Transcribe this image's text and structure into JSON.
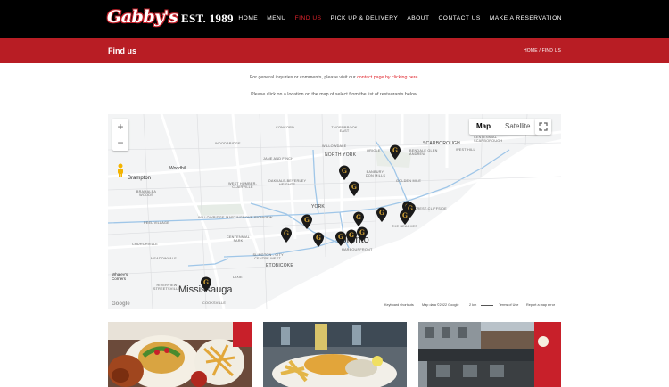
{
  "header": {
    "logo_text": "Gabby's",
    "est_text": "EST. 1989",
    "nav": [
      {
        "label": "HOME",
        "active": false
      },
      {
        "label": "MENU",
        "active": false
      },
      {
        "label": "FIND US",
        "active": true
      },
      {
        "label": "PICK UP & DELIVERY",
        "active": false
      },
      {
        "label": "ABOUT",
        "active": false
      },
      {
        "label": "CONTACT US",
        "active": false
      },
      {
        "label": "MAKE A RESERVATION",
        "active": false
      }
    ]
  },
  "title_bar": {
    "title": "Find us",
    "breadcrumb_home": "HOME",
    "breadcrumb_sep": "/",
    "breadcrumb_current": "FIND US"
  },
  "intro": {
    "line1_pre": "For general inquiries or comments, please visit our ",
    "line1_link": "contact page by clicking here.",
    "line2": "Please click on a location on the map of select from the list of restaurants below."
  },
  "map": {
    "map_button": "Map",
    "satellite_button": "Satellite",
    "zoom_in": "+",
    "zoom_out": "−",
    "labels": {
      "concord": "CONCORD",
      "thornhill": "THORNBROOK EAST",
      "willowdale": "WILLOWDALE",
      "north_york": "NORTH YORK",
      "scarborough": "SCARBOROUGH",
      "scarb_centre": "CENTENNIAL SCARBOROUGH",
      "bendale": "BENDALE GLEN ANDREW",
      "west_hill": "WEST HILL",
      "woodbridge": "WOODBRIDGE",
      "jane_finch": "JANE AND FINCH",
      "oakdale": "OAKDALE-BEVERLEY HEIGHTS",
      "west_humber": "WEST HUMBER-CLAIRVILLE",
      "banbury": "BANBURY-DON MILLS",
      "golden_mile": "GOLDEN MILE",
      "york": "YORK",
      "brampton": "Brampton",
      "woodhill": "Woodhill",
      "bramalea": "BRAMALEA WOODS",
      "peel_village": "PEEL VILLAGE",
      "willowridge": "WILLOWRIDGE-MARTINGROVE-RICHVIEW",
      "centennial_park": "CENTENNIAL PARK",
      "cliffside": "CLIFFCREST-CLIFFSIDE",
      "the_beaches": "THE BEACHES",
      "churchville": "CHURCHVILLE",
      "meadowvale": "MEADOWVALE",
      "islington": "ISLINGTON - CITY CENTRE WEST",
      "toronto": "Toronto",
      "harbourfront": "HARBOURFRONT",
      "etobicoke": "ETOBICOKE",
      "dixie": "DIXIE",
      "whaleys": "Whaley's Corners",
      "riverview": "RIVERVIEW STREETSVILLE",
      "mississauga": "Mississauga",
      "cooksville": "COOKSVILLE",
      "oriole": "Oriole"
    },
    "footer": {
      "google": "Google",
      "shortcuts": "Keyboard shortcuts",
      "data": "Map data ©2022 Google",
      "scale": "2 km",
      "terms": "Terms of Use",
      "report": "Report a map error"
    },
    "pin_count": 15
  },
  "colors": {
    "brand_red": "#b81d24",
    "nav_active": "#e0242c",
    "pin_fill": "#1a1a1a",
    "pin_mark": "#d4a437"
  }
}
